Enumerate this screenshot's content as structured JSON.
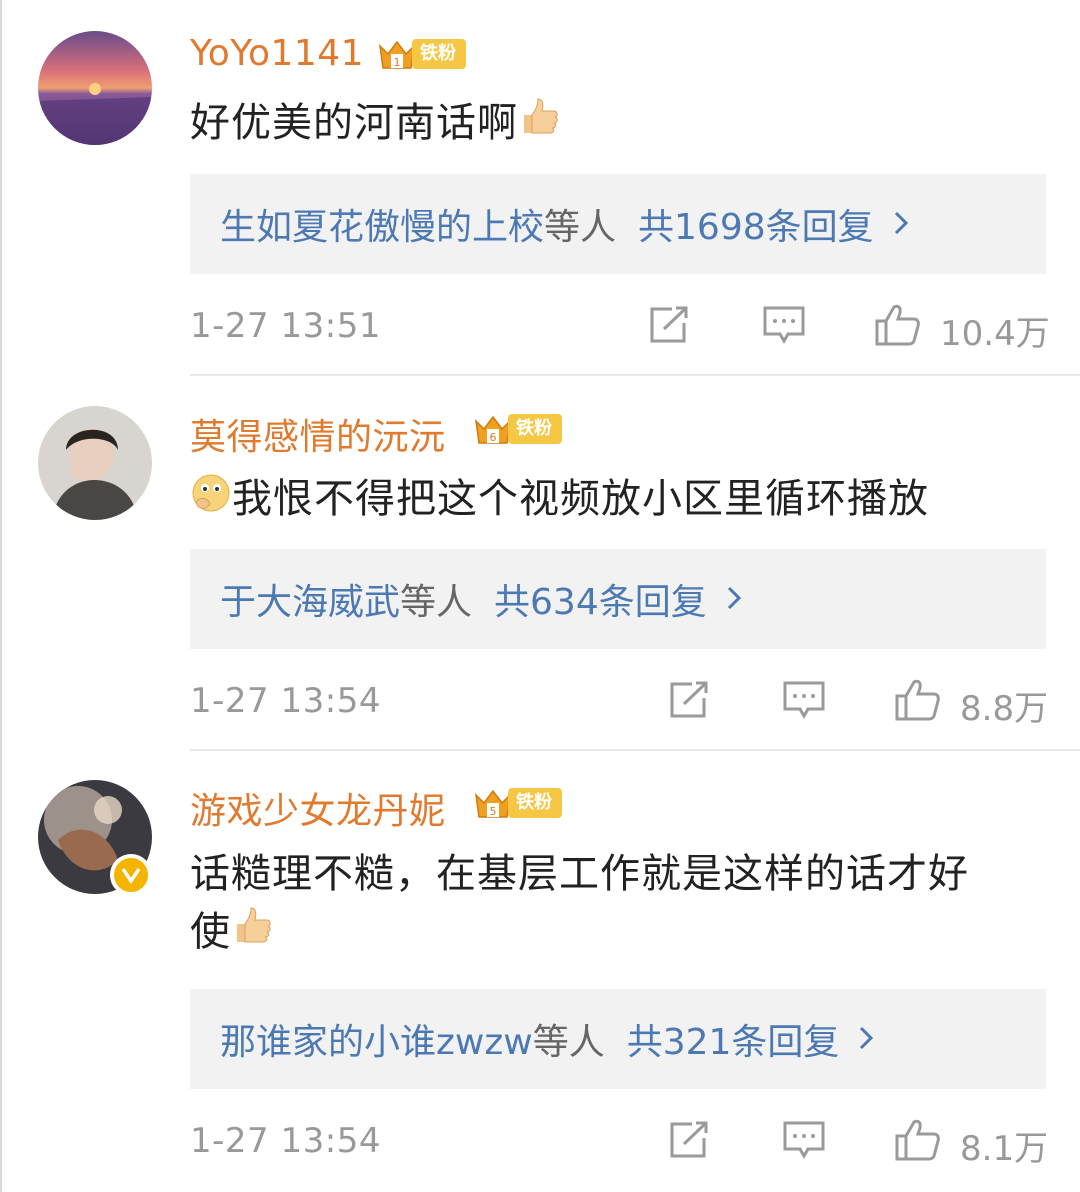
{
  "comments": [
    {
      "username": "YoYo1141",
      "badge": "铁粉",
      "text": "好优美的河南话啊",
      "reply_names": "生如夏花傲慢的上校",
      "reply_etc": "等人",
      "reply_count": "共1698条回复",
      "time": "1-27 13:51",
      "likes": "10.4万"
    },
    {
      "username": "莫得感情的沅沅",
      "badge": "铁粉",
      "text": "我恨不得把这个视频放小区里循环播放",
      "reply_names": "于大海威武",
      "reply_etc": "等人",
      "reply_count": "共634条回复",
      "time": "1-27 13:54",
      "likes": "8.8万"
    },
    {
      "username": "游戏少女龙丹妮",
      "badge": "铁粉",
      "text_line1": "话糙理不糙，在基层工作就是这样的话才好",
      "text_line2": "使",
      "reply_names": "那谁家的小谁zwzw",
      "reply_etc": "等人",
      "reply_count": "共321条回复",
      "time": "1-27 13:54",
      "likes": "8.1万"
    }
  ],
  "colors": {
    "username": "#e07a2e",
    "link": "#4d79b3",
    "meta": "#999999",
    "badge": "#f6c744"
  },
  "icons": [
    "share-icon",
    "comment-icon",
    "like-icon",
    "chevron-right-icon",
    "thumbs-up-emoji",
    "thinking-emoji",
    "verified-icon",
    "crown-icon"
  ]
}
